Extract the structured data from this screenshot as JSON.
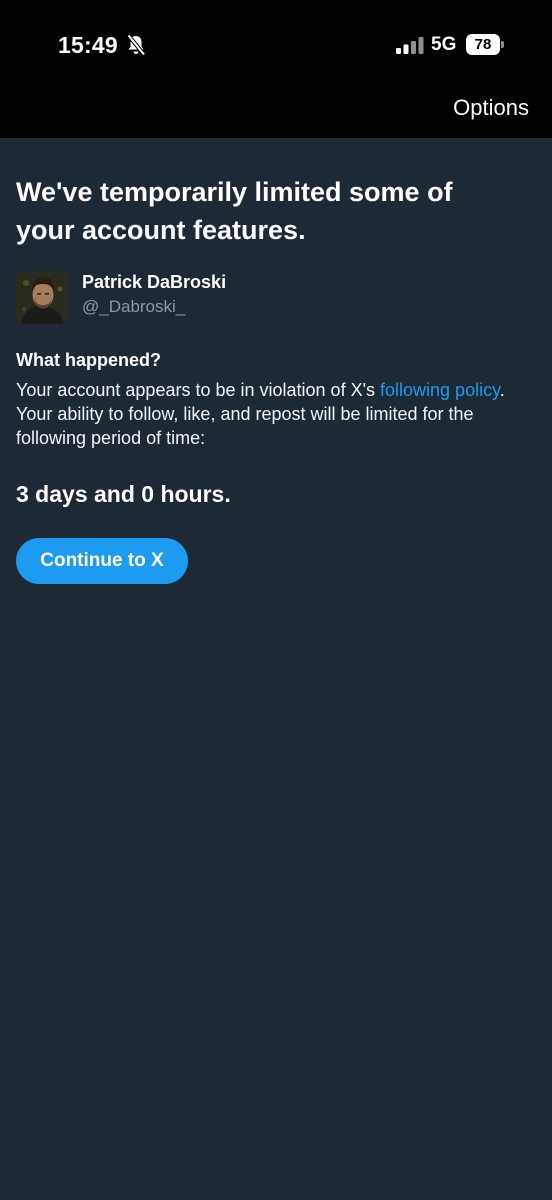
{
  "status_bar": {
    "time": "15:49",
    "network": "5G",
    "battery_level": "78",
    "icons": [
      "bell-slash-icon",
      "signal-icon",
      "battery-icon"
    ]
  },
  "header": {
    "options_label": "Options"
  },
  "notice": {
    "headline": "We've temporarily limited some of your account features.",
    "user": {
      "display_name": "Patrick DaBroski",
      "handle": "@_Dabroski_"
    },
    "section_title": "What happened?",
    "body_before_link": "Your account appears to be in violation of X's ",
    "link_text": "following policy",
    "body_after_link": ". Your ability to follow, like, and repost will be limited for the following period of time:",
    "duration": "3 days and 0 hours."
  },
  "actions": {
    "continue_label": "Continue to X"
  },
  "colors": {
    "background": "#1e2936",
    "top_bar": "#000000",
    "accent": "#1d9bf0",
    "muted_text": "#8b98a5"
  }
}
